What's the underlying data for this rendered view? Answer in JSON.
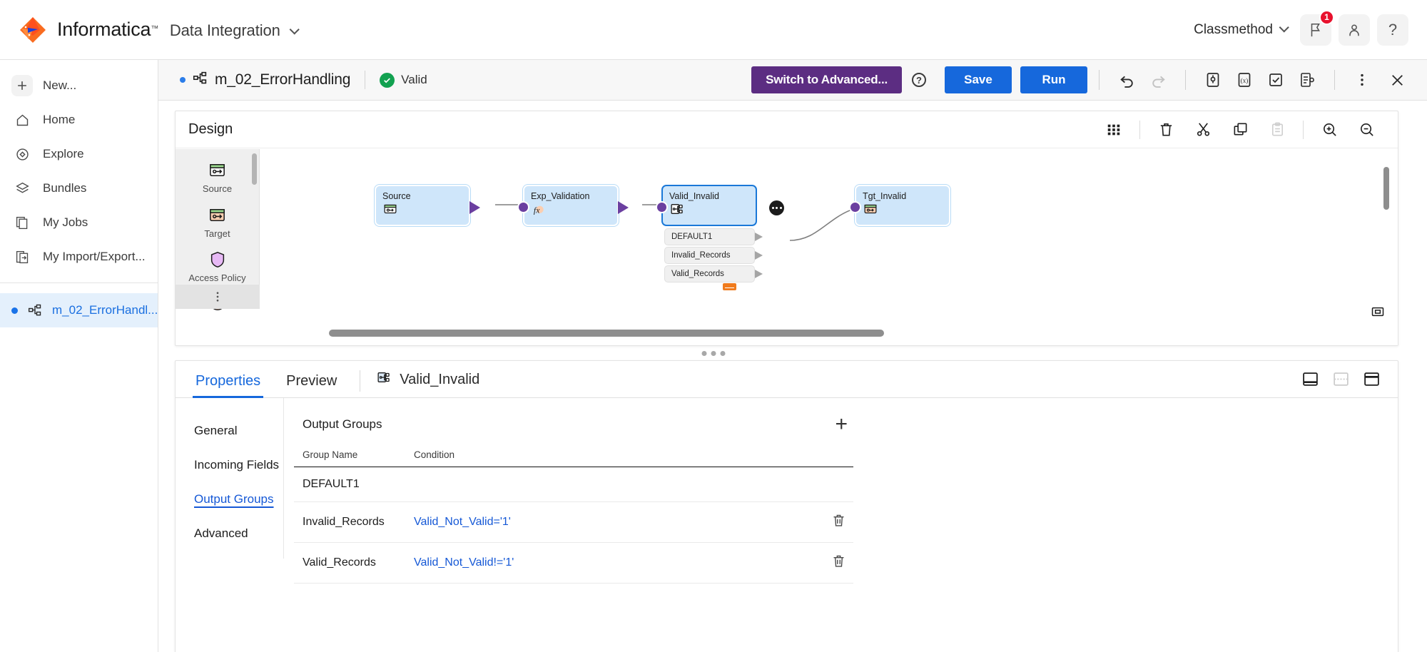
{
  "header": {
    "brand": "Informatica",
    "tm": "™",
    "product": "Data Integration",
    "org": "Classmethod",
    "notifications_badge": "1",
    "icons": {
      "flag": "flag-icon",
      "user": "user-icon",
      "help": "?"
    }
  },
  "sidebar": {
    "items": [
      {
        "label": "New...",
        "icon": "plus-icon"
      },
      {
        "label": "Home",
        "icon": "home-icon"
      },
      {
        "label": "Explore",
        "icon": "compass-icon"
      },
      {
        "label": "Bundles",
        "icon": "layers-icon"
      },
      {
        "label": "My Jobs",
        "icon": "documents-icon"
      },
      {
        "label": "My Import/Export...",
        "icon": "import-export-icon"
      }
    ],
    "open_asset": {
      "label": "m_02_ErrorHandl...",
      "icon": "mapping-icon"
    }
  },
  "toolbar": {
    "mapping_name": "m_02_ErrorHandling",
    "status": "Valid",
    "switch_advanced": "Switch to Advanced...",
    "help": "?",
    "save": "Save",
    "run": "Run",
    "icons": [
      "undo-icon",
      "redo-icon",
      "parameters-icon",
      "expression-macro-icon",
      "validate-icon",
      "mapping-doc-icon",
      "kebab-menu-icon",
      "close-icon"
    ]
  },
  "design": {
    "title": "Design",
    "tools": [
      "grid-icon",
      "delete-icon",
      "cut-icon",
      "copy-icon",
      "paste-icon",
      "zoom-in-icon",
      "zoom-out-icon"
    ],
    "palette": [
      {
        "label": "Source",
        "icon": "source-icon"
      },
      {
        "label": "Target",
        "icon": "target-icon"
      },
      {
        "label": "Access Policy",
        "icon": "shield-icon"
      },
      {
        "label": "",
        "icon": "aggregator-icon"
      }
    ],
    "palette_more": "kebab-icon",
    "nodes": [
      {
        "name": "Source",
        "icon": "source-icon"
      },
      {
        "name": "Exp_Validation",
        "icon": "expression-icon"
      },
      {
        "name": "Valid_Invalid",
        "icon": "router-icon",
        "selected": true
      },
      {
        "name": "Tgt_Invalid",
        "icon": "target-icon"
      }
    ],
    "output_groups": [
      "DEFAULT1",
      "Invalid_Records",
      "Valid_Records"
    ]
  },
  "panel": {
    "tabs": [
      {
        "label": "Properties",
        "active": true
      },
      {
        "label": "Preview",
        "active": false
      }
    ],
    "selected_node": "Valid_Invalid",
    "nav": [
      {
        "label": "General",
        "active": false
      },
      {
        "label": "Incoming Fields",
        "active": false
      },
      {
        "label": "Output Groups",
        "active": true
      },
      {
        "label": "Advanced",
        "active": false
      }
    ],
    "section_title": "Output Groups",
    "add_label": "+",
    "columns": [
      "Group Name",
      "Condition"
    ],
    "rows": [
      {
        "group": "DEFAULT1",
        "condition": "",
        "deletable": false
      },
      {
        "group": "Invalid_Records",
        "condition": "Valid_Not_Valid='1'",
        "deletable": true
      },
      {
        "group": "Valid_Records",
        "condition": "Valid_Not_Valid!='1'",
        "deletable": true
      }
    ]
  },
  "colors": {
    "accent_blue": "#1668dc",
    "advanced_purple": "#5c2d82",
    "valid_green": "#12a150",
    "badge_red": "#e8112d",
    "node_fill": "#cfe6fa",
    "port_purple": "#6b3fa0",
    "collapse_orange": "#f07b1d"
  }
}
